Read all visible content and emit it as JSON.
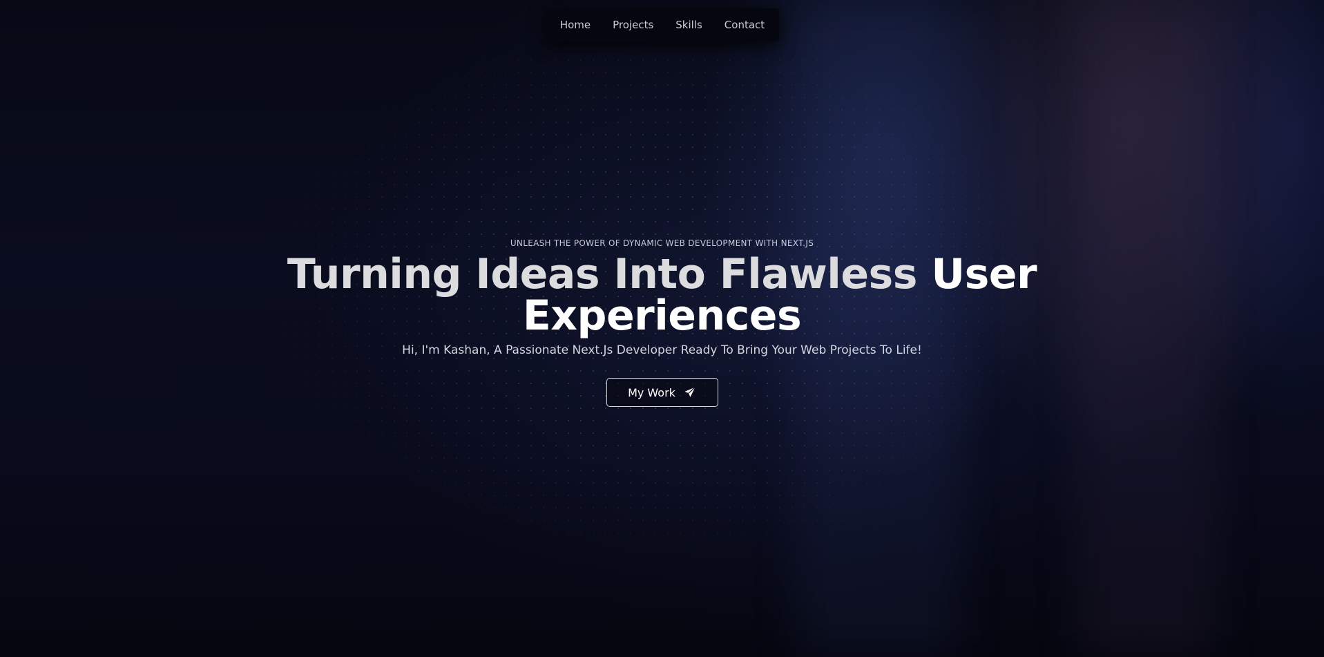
{
  "nav": {
    "items": [
      {
        "label": "Home"
      },
      {
        "label": "Projects"
      },
      {
        "label": "Skills"
      },
      {
        "label": "Contact"
      }
    ]
  },
  "hero": {
    "eyebrow": "Unleash the power of dynamic web development with Next.js",
    "headline_muted": "Turning Ideas Into Flawless",
    "headline_bright_1": "User",
    "headline_bright_2": "Experiences",
    "subtitle": "Hi, I'm Kashan, A Passionate Next.Js Developer Ready To Bring Your Web Projects To Life!",
    "cta_label": "My Work",
    "cta_icon": "send-icon"
  },
  "colors": {
    "background": "#05060f",
    "headline_bright": "#ffffff",
    "headline_muted": "#dcdcde",
    "nav_text": "#c9ccd8"
  }
}
